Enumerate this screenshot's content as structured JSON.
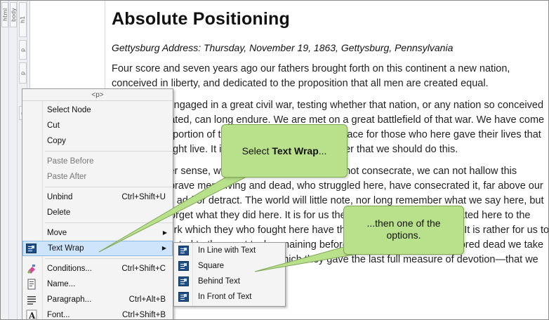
{
  "structure_bar": {
    "tags": [
      "html",
      "body",
      "h1",
      "p",
      "p",
      "p"
    ]
  },
  "document": {
    "title": "Absolute Positioning",
    "subtitle": "Gettysburg Address: Thursday, November 19, 1863, Gettysburg, Pennsylvania",
    "paragraphs": [
      "Four score and seven years ago our fathers brought forth on this continent a new nation, conceived in liberty, and dedicated to the proposition that all men are created equal.",
      "Now we are engaged in a great civil war, testing whether that nation, or any nation so conceived and so dedicated, can long endure. We are met on a great battlefield of that war. We have come to dedicate a portion of that field, as a final resting place for those who here gave their lives that that nation might live. It is altogether fitting and proper that we should do this.",
      "But, in a larger sense, we can not dedicate, we can not consecrate, we can not hallow this ground. The brave men, living and dead, who struggled here, have consecrated it, far above our poor power to add or detract. The world will little note, nor long remember what we say here, but it can never forget what they did here. It is for us the living, rather, to be dedicated here to the unfinished work which they who fought here have thus far so nobly advanced. It is rather for us to be here dedicated to the great task remaining before us—that from these honored dead we take increased devotion to that cause for which they gave the last full measure of devotion—that we here highly resolve that"
    ]
  },
  "context_menu": {
    "header": "<p>",
    "items": [
      {
        "label": "Select Node",
        "shortcut": ""
      },
      {
        "label": "Cut",
        "shortcut": ""
      },
      {
        "label": "Copy",
        "shortcut": ""
      },
      {
        "label": "Paste Before",
        "shortcut": ""
      },
      {
        "label": "Paste After",
        "shortcut": ""
      },
      {
        "label": "Unbind",
        "shortcut": "Ctrl+Shift+U"
      },
      {
        "label": "Delete",
        "shortcut": ""
      },
      {
        "label": "Move",
        "shortcut": ""
      },
      {
        "label": "Text Wrap",
        "shortcut": ""
      },
      {
        "label": "Conditions...",
        "shortcut": "Ctrl+Shift+C"
      },
      {
        "label": "Name...",
        "shortcut": ""
      },
      {
        "label": "Paragraph...",
        "shortcut": "Ctrl+Alt+B"
      },
      {
        "label": "Font...",
        "shortcut": "Ctrl+Shift+B"
      }
    ]
  },
  "text_wrap_submenu": {
    "items": [
      "In Line with Text",
      "Square",
      "Behind Text",
      "In Front of Text"
    ]
  },
  "callouts": {
    "first_prefix": "Select ",
    "first_bold": "Text Wrap",
    "first_suffix": "...",
    "second": "...then one of the options."
  },
  "colors": {
    "callout_fill": "#b9e08a",
    "menu_highlight": "#cde4fb"
  }
}
